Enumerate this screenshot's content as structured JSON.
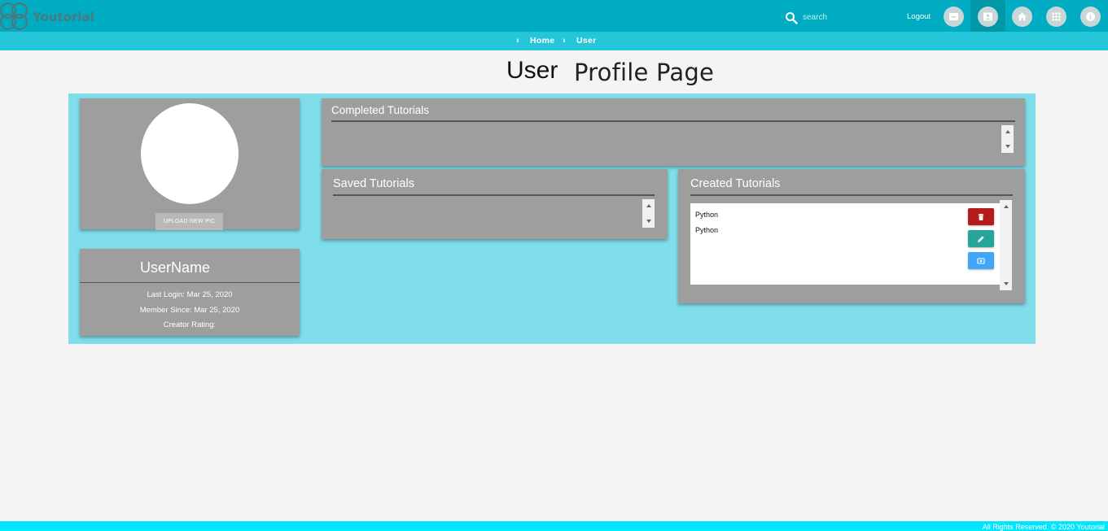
{
  "navbar": {
    "brand": "Youtorial",
    "search_placeholder": "search",
    "logout_label": "Logout",
    "icons": [
      "dashboard-icon",
      "profile-icon",
      "home-icon",
      "apps-icon",
      "info-icon"
    ]
  },
  "breadcrumb": {
    "items": [
      "Home",
      "User"
    ]
  },
  "page": {
    "title_bold": "User",
    "title_rest": "Profile Page"
  },
  "profile": {
    "upload_label": "UPLOAD NEW PIC",
    "username": "UserName",
    "last_login": "Last Login: Mar 25, 2020",
    "member_since": "Member Since: Mar 25, 2020",
    "creator_rating": "Creator Rating:"
  },
  "completed": {
    "title": "Completed Tutorials"
  },
  "saved": {
    "title": "Saved Tutorials"
  },
  "created": {
    "title": "Created Tutorials",
    "items": [
      "Python",
      "Python"
    ]
  },
  "footer": {
    "text": "All Rights Reserved. © 2020 Youtorial"
  },
  "colors": {
    "navbar": "#00acc1",
    "breadcrumb_bar": "#26c6da",
    "panel": "#80deea",
    "card": "#9e9e9e",
    "delete": "#b71c1c",
    "edit": "#26a69a",
    "view": "#42a5f5",
    "footer": "#00e5ff"
  }
}
